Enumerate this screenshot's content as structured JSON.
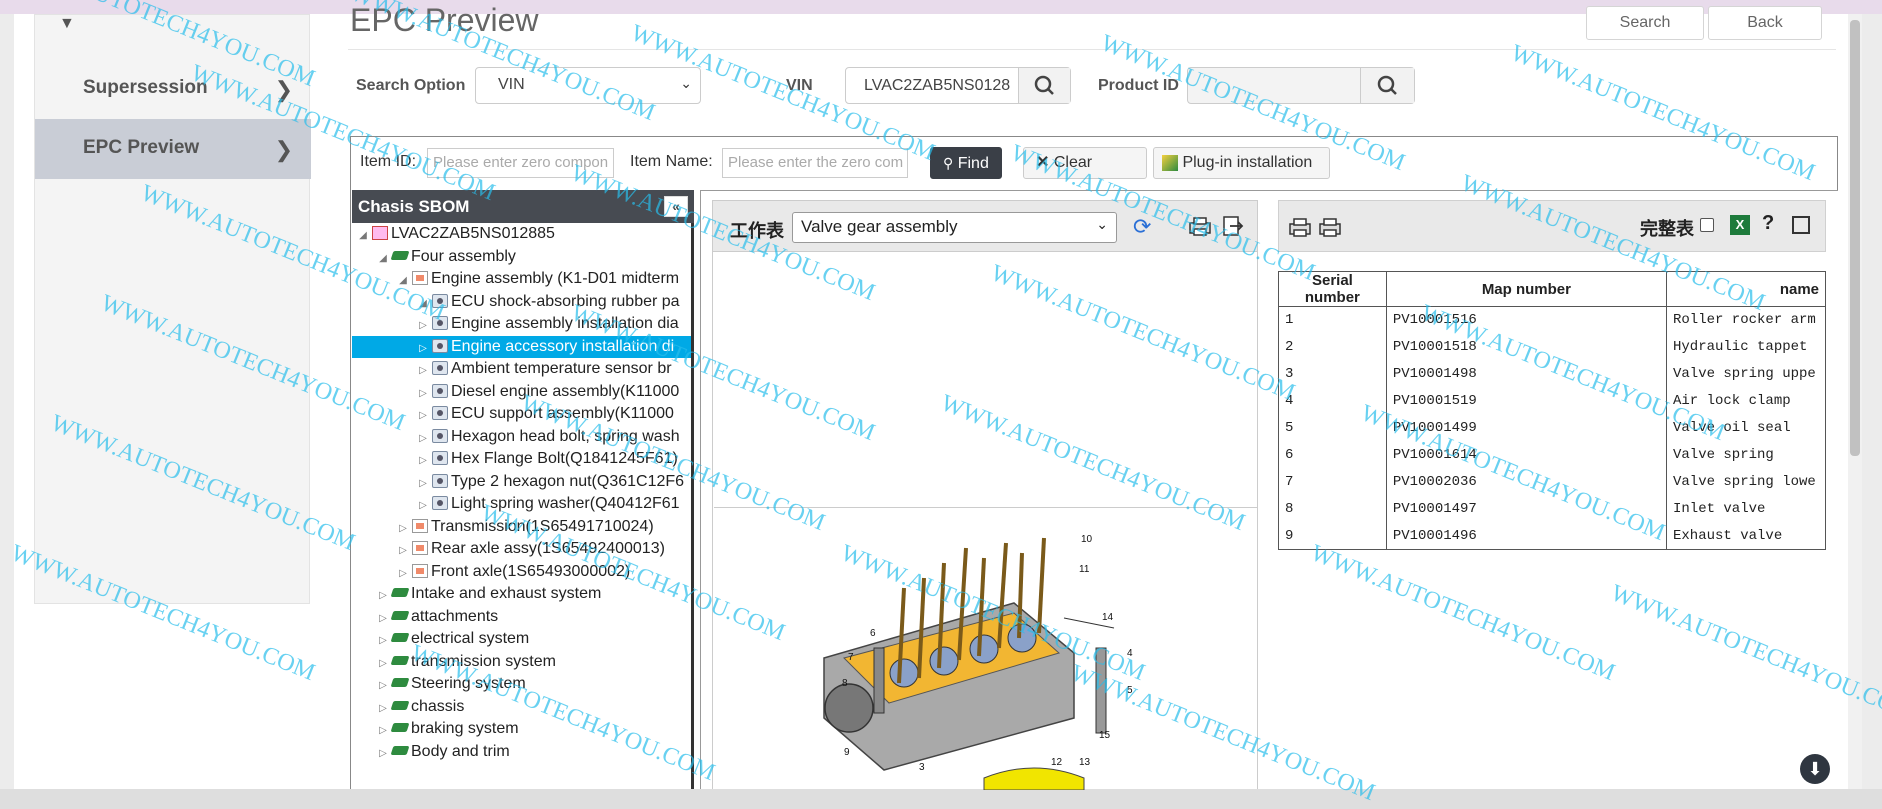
{
  "sidebar": {
    "items": [
      {
        "label": "Supersession"
      },
      {
        "label": "EPC Preview"
      }
    ]
  },
  "header": {
    "title": "EPC Preview",
    "search_button": "Search",
    "back_button": "Back"
  },
  "search": {
    "option_label": "Search Option",
    "option_value": "VIN",
    "vin_label": "VIN",
    "vin_value": "LVAC2ZAB5NS0128",
    "product_label": "Product ID",
    "product_value": ""
  },
  "filter": {
    "item_id_label": "Item ID:",
    "item_id_placeholder": "Please enter zero compon",
    "item_name_label": "Item Name:",
    "item_name_placeholder": "Please enter the zero com",
    "find_button": "Find",
    "clear_button": "Clear",
    "plugin_button": "Plug-in installation"
  },
  "tree": {
    "title": "Chasis SBOM",
    "nodes": [
      {
        "label": "LVAC2ZAB5NS012885"
      },
      {
        "label": "Four assembly"
      },
      {
        "label": "Engine assembly (K1-D01 midterm"
      },
      {
        "label": "ECU shock-absorbing rubber pa"
      },
      {
        "label": "Engine assembly installation dia"
      },
      {
        "label": "Engine accessory installation di"
      },
      {
        "label": "Ambient temperature sensor br"
      },
      {
        "label": "Diesel engine assembly(K11000"
      },
      {
        "label": "ECU support assembly(K11000"
      },
      {
        "label": "Hexagon head bolt, spring wash"
      },
      {
        "label": "Hex Flange Bolt(Q1841245F61)"
      },
      {
        "label": "Type 2 hexagon nut(Q361C12F6"
      },
      {
        "label": "Light spring washer(Q40412F61"
      },
      {
        "label": "Transmission(1S65491710024)"
      },
      {
        "label": "Rear axle assy(1S65492400013)"
      },
      {
        "label": "Front axle(1S65493000002)"
      },
      {
        "label": "Intake and exhaust system"
      },
      {
        "label": "attachments"
      },
      {
        "label": "electrical system"
      },
      {
        "label": "transmission system"
      },
      {
        "label": "Steering system"
      },
      {
        "label": "chassis"
      },
      {
        "label": "braking system"
      },
      {
        "label": "Body and trim"
      }
    ]
  },
  "worksheet": {
    "label": "工作表",
    "selected": "Valve gear assembly",
    "callouts": [
      "10",
      "11",
      "6",
      "7",
      "8",
      "9",
      "14",
      "4",
      "5",
      "15",
      "3",
      "12",
      "13"
    ]
  },
  "parts_table": {
    "full_label": "完整表",
    "headers": [
      "Serial number",
      "Map number",
      "name"
    ],
    "rows": [
      [
        "1",
        "PV10001516",
        "Roller rocker arm"
      ],
      [
        "2",
        "PV10001518",
        "Hydraulic tappet"
      ],
      [
        "3",
        "PV10001498",
        "Valve spring uppe"
      ],
      [
        "4",
        "PV10001519",
        "Air lock clamp"
      ],
      [
        "5",
        "PV10001499",
        "Valve oil seal"
      ],
      [
        "6",
        "PV10001614",
        "Valve spring"
      ],
      [
        "7",
        "PV10002036",
        "Valve spring lowe"
      ],
      [
        "8",
        "PV10001497",
        "Inlet valve"
      ],
      [
        "9",
        "PV10001496",
        "Exhaust valve"
      ]
    ]
  },
  "watermark": "WWW.AUTOTECH4YOU.COM",
  "colors": {
    "selected": "#00a9e6",
    "tree_header": "#474b52",
    "watermark": "#28bee9"
  }
}
